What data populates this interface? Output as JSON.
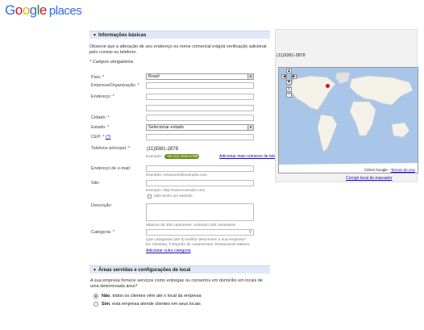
{
  "logo": {
    "brand": "Google",
    "product": "places"
  },
  "basic_info": {
    "header": "Informações básicas",
    "intro": "Observe que a alteração de seu endereço ou nome comercial exigirá verificação adicional pelo correio ou telefone.",
    "required_note": "* Campos obrigatórios",
    "country_label": "País: *",
    "country_value": "Brasil",
    "company_label": "Empresa/Organização: *",
    "address_label": "Endereço: *",
    "city_label": "Cidade: *",
    "state_label": "Estado: *",
    "state_value": "Selecionar estado",
    "cep_label": "CEP: *",
    "cep_help": "(?)",
    "phone_label": "Telefone principal: *",
    "phone_value": "(11)9381-2878",
    "phone_example_prefix": "Exemplo:",
    "phone_example": "+55 (11) 3345-6789",
    "add_phone_link": "Adicionar mais números de telefone",
    "email_label": "Endereço de e-mail:",
    "email_example": "Exemplo: meunome@exemplo.com",
    "site_label": "Site:",
    "site_example": "Exemplo: http://www.exemplo.com",
    "no_site_label": "Não tenho um website",
    "description_label": "Descrição:",
    "description_hint": "Máximo de 200 caracteres, restando 200 caracteres",
    "category_label": "Categoria: *",
    "category_hint1": "Que categorias (até 5) melhor descrevem a sua empresa?",
    "category_hint2": "Ex: Dentista, Fotógrafo de casamentos, Restaurante italiano.",
    "add_category_link": "Adicionar outra categoria"
  },
  "map": {
    "phone": "(11)9381-2878",
    "copyright": "©2012 Google -",
    "terms_link": "Termos de Uso",
    "fix_marker_link": "Corrigir local do marcador"
  },
  "service_areas": {
    "header": "Áreas servidas e configurações de local",
    "question": "A sua empresa fornece serviços como entregas ou consertos em domicílio em locais de uma determinada área?",
    "option_no_bold": "Não",
    "option_no_rest": ", todos os clientes vêm até o local da empresa",
    "option_yes_bold": "Sim",
    "option_yes_rest": ", esta empresa atende clientes em seus locais"
  },
  "colors": {
    "section_bg": "#dfe8f6",
    "link": "#1a0dab",
    "map_water": "#a9c6e8",
    "map_land": "#f4f1e8"
  },
  "icons": [
    "triangle-down-icon",
    "dropdown-arrow-icon",
    "search-icon",
    "zoom-in-icon",
    "zoom-out-icon",
    "pan-icon",
    "globe-icon",
    "map-marker-icon"
  ]
}
